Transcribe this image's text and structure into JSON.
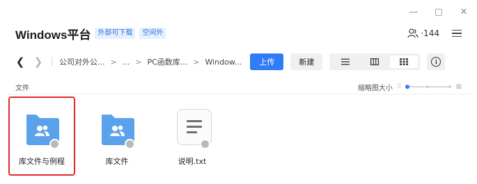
{
  "window": {
    "controls": [
      "minimize",
      "maximize",
      "close"
    ]
  },
  "header": {
    "title": "Windows平台",
    "tags": [
      "外部可下载",
      "空间外"
    ],
    "member_count": "·144"
  },
  "toolbar": {
    "breadcrumb": [
      "公司对外公...",
      "...",
      "PC函数库...",
      "Window..."
    ],
    "upload_label": "上传",
    "new_label": "新建",
    "view_modes": [
      "list",
      "detail",
      "grid"
    ],
    "active_view": "grid"
  },
  "list_header": {
    "column_label": "文件",
    "thumb_size_label": "缩略图大小",
    "thumb_size_level": 0.0
  },
  "files": [
    {
      "name": "库文件与例程",
      "type": "folder",
      "icon": "shared-folder-icon",
      "selected": true
    },
    {
      "name": "库文件",
      "type": "folder",
      "icon": "shared-folder-icon",
      "selected": false
    },
    {
      "name": "说明.txt",
      "type": "text-file",
      "icon": "text-file-icon",
      "selected": false
    }
  ],
  "colors": {
    "accent": "#2f7cf6",
    "folder": "#5aa2ec",
    "selection": "#e0282e",
    "tag_bg": "#e6f0ff"
  }
}
